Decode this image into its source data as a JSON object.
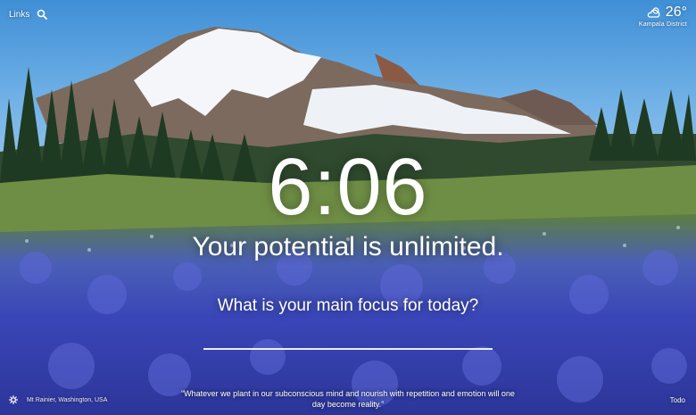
{
  "topbar": {
    "links_label": "Links",
    "search_icon": "search-icon"
  },
  "weather": {
    "icon": "cloud-sun-icon",
    "temperature": "26°",
    "location": "Kampala District"
  },
  "main": {
    "time": "6:06",
    "mantra": "Your potential is unlimited.",
    "focus_question": "What is your main focus for today?",
    "focus_value": ""
  },
  "footer": {
    "settings_icon": "gear-icon",
    "photo_credit": "Mt Rainier, Washington, USA",
    "quote": "“Whatever we plant in our subconscious mind and nourish with repetition and emotion will one day become reality.”",
    "todo_label": "Todo"
  },
  "colors": {
    "sky_top": "#3f8fd6",
    "meadow_flowers": "#3a46b8",
    "text": "#ffffff"
  }
}
